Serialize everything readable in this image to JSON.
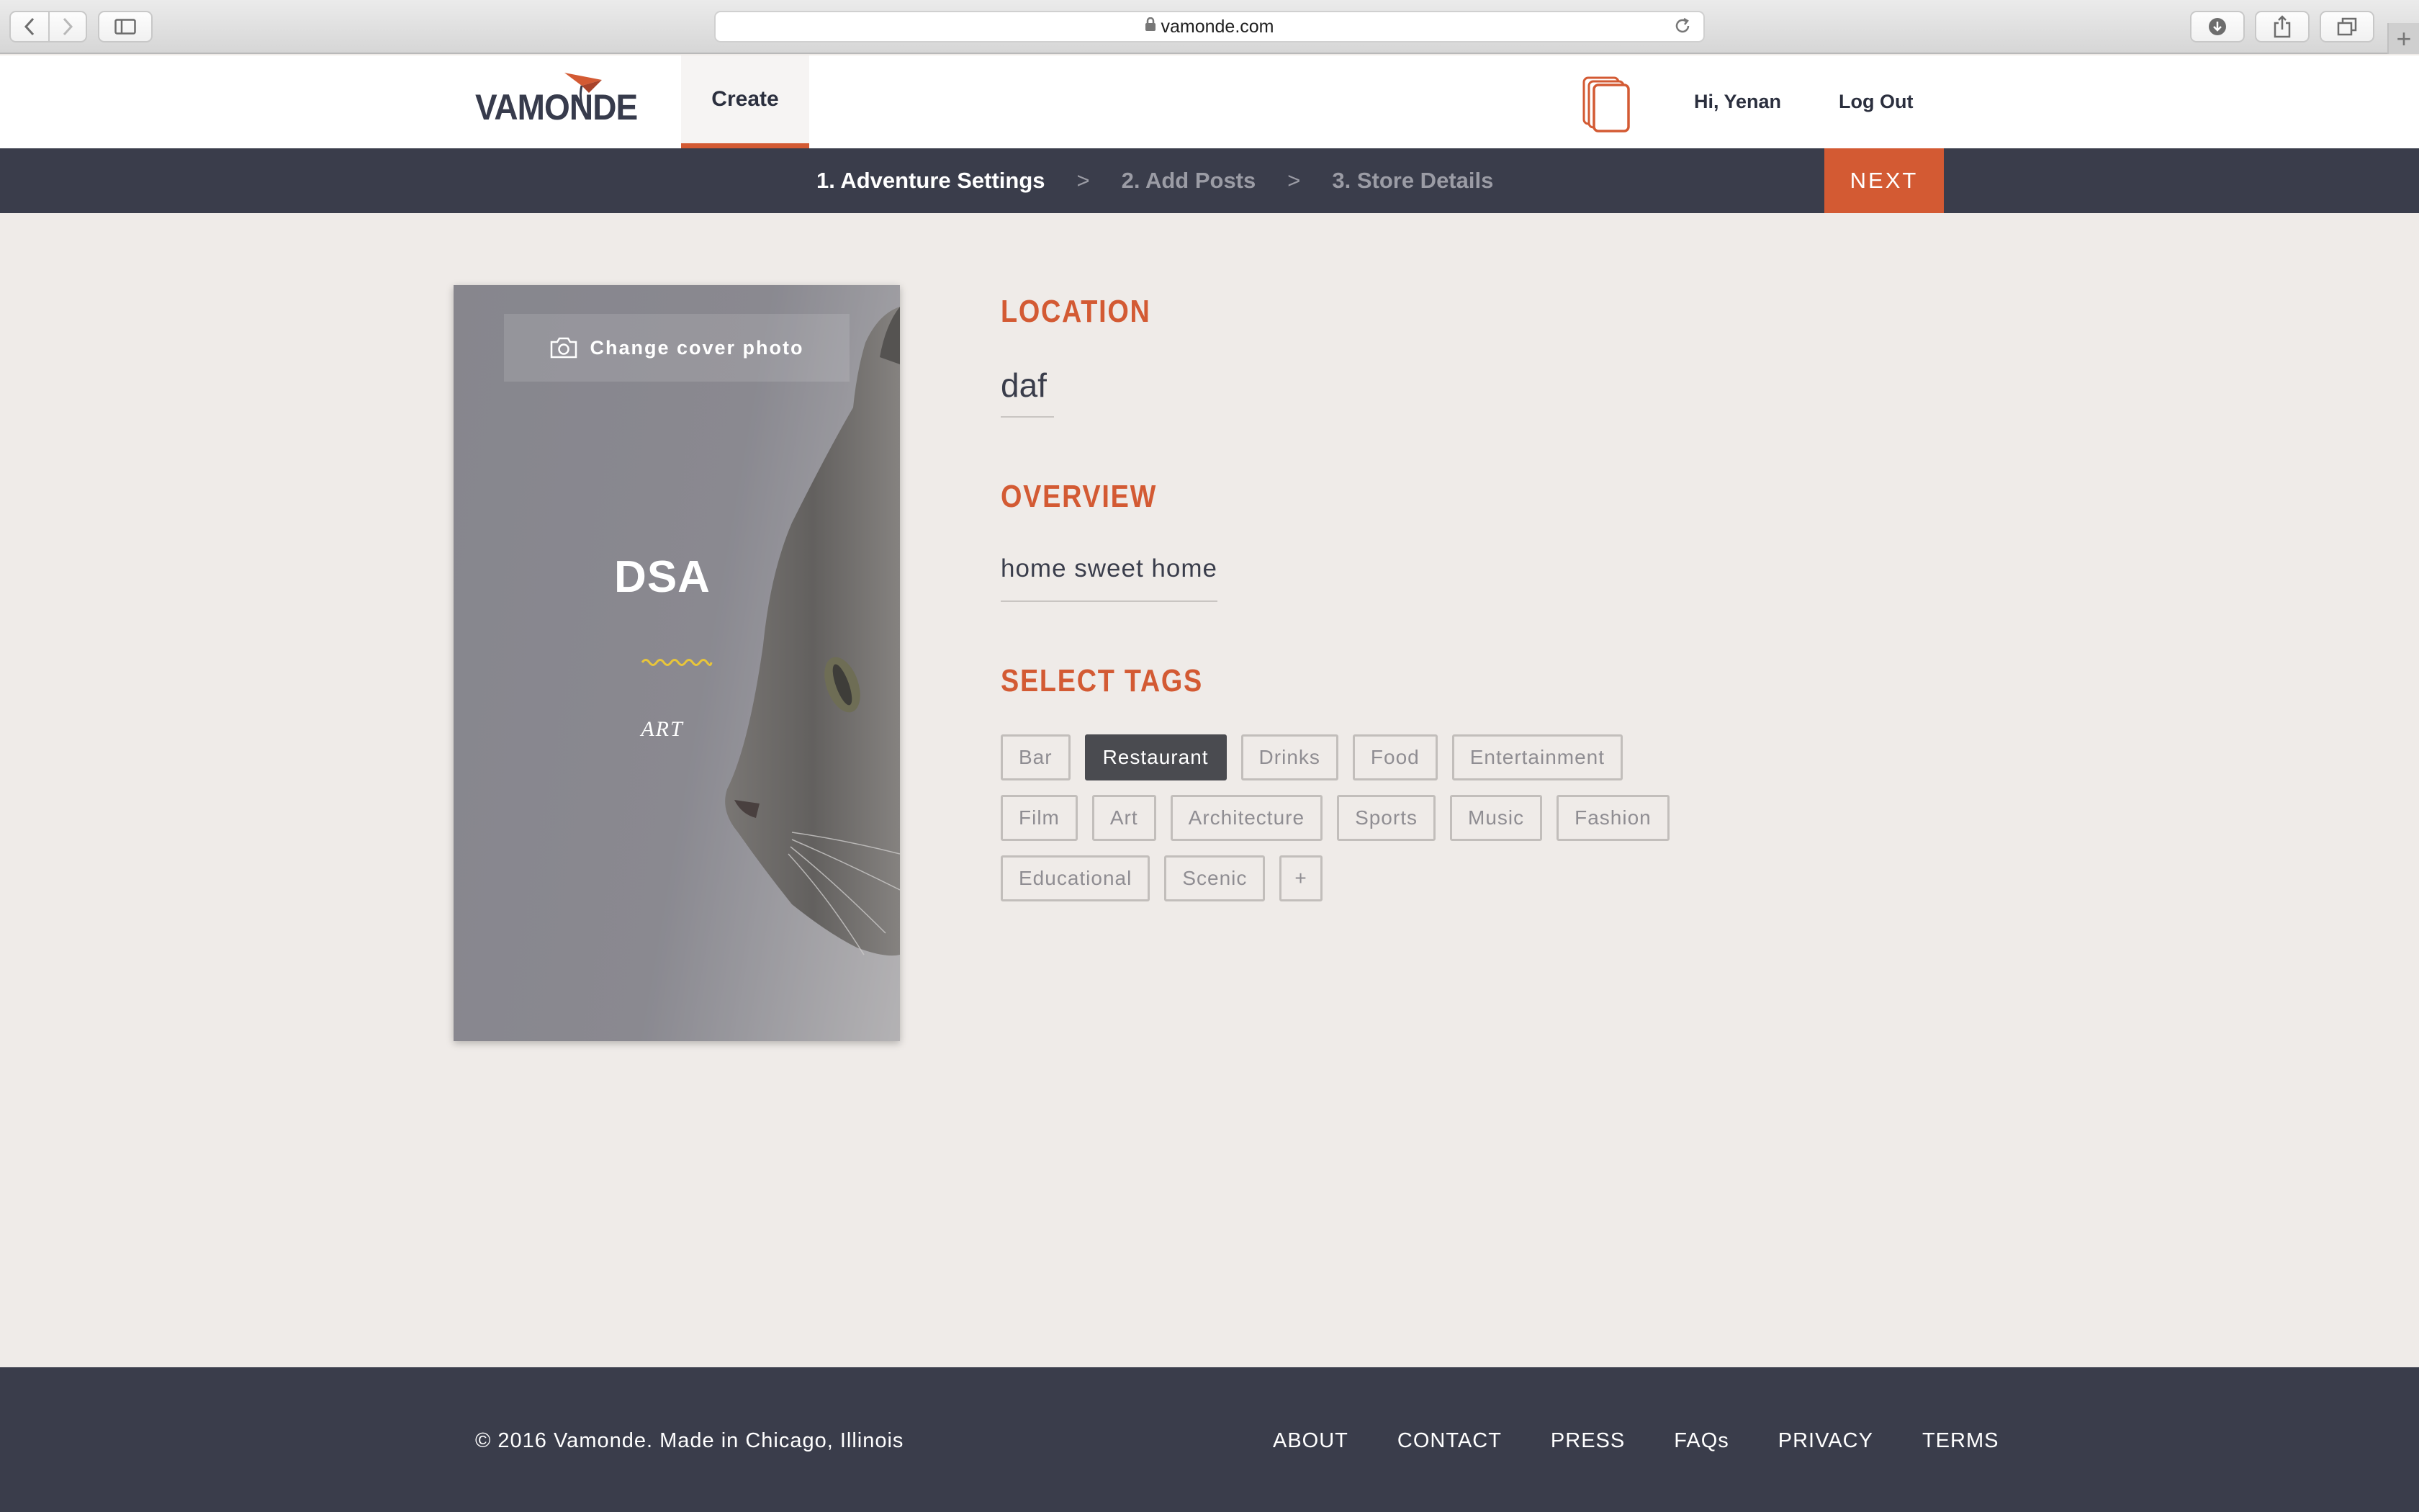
{
  "browser": {
    "url": "vamonde.com"
  },
  "header": {
    "logo_text": "VAMONDE",
    "create_tab": "Create",
    "greeting": "Hi, Yenan",
    "logout": "Log Out"
  },
  "steps": {
    "items": [
      {
        "label": "1. Adventure Settings",
        "active": true
      },
      {
        "label": "2. Add Posts",
        "active": false
      },
      {
        "label": "3. Store Details",
        "active": false
      }
    ],
    "separator": ">",
    "next_label": "NEXT"
  },
  "cover": {
    "change_photo_label": "Change cover photo",
    "title": "DSA",
    "category": "ART"
  },
  "form": {
    "location_label": "LOCATION",
    "location_value": "daf",
    "overview_label": "OVERVIEW",
    "overview_value": "home sweet home",
    "tags_label": "SELECT TAGS",
    "tags": [
      {
        "label": "Bar",
        "selected": false
      },
      {
        "label": "Restaurant",
        "selected": true
      },
      {
        "label": "Drinks",
        "selected": false
      },
      {
        "label": "Food",
        "selected": false
      },
      {
        "label": "Entertainment",
        "selected": false
      },
      {
        "label": "Film",
        "selected": false
      },
      {
        "label": "Art",
        "selected": false
      },
      {
        "label": "Architecture",
        "selected": false
      },
      {
        "label": "Sports",
        "selected": false
      },
      {
        "label": "Music",
        "selected": false
      },
      {
        "label": "Fashion",
        "selected": false
      },
      {
        "label": "Educational",
        "selected": false
      },
      {
        "label": "Scenic",
        "selected": false
      }
    ],
    "add_tag_label": "+"
  },
  "footer": {
    "copyright": "© 2016 Vamonde. Made in Chicago, Illinois",
    "links": [
      "ABOUT",
      "CONTACT",
      "PRESS",
      "FAQs",
      "PRIVACY",
      "TERMS"
    ]
  },
  "colors": {
    "accent": "#d35a33",
    "dark": "#3a3d4b",
    "background": "#efebe8",
    "selected_tag": "#4a4b50"
  }
}
